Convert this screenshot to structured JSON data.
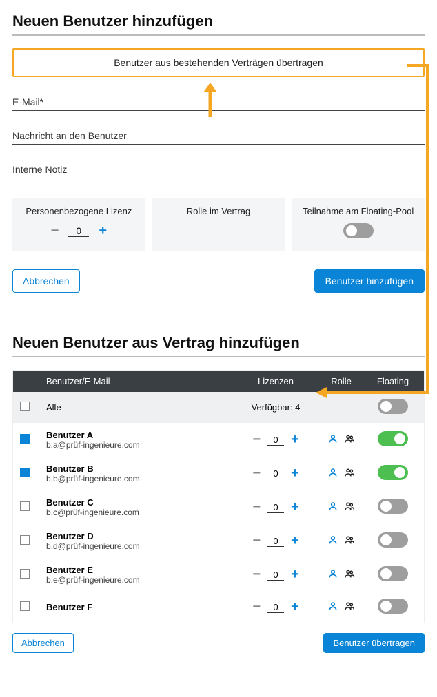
{
  "top": {
    "heading": "Neuen Benutzer hinzufügen",
    "transfer_button": "Benutzer aus bestehenden Verträgen übertragen",
    "email_label": "E-Mail*",
    "message_label": "Nachricht an den Benutzer",
    "note_label": "Interne Notiz",
    "cards": {
      "license": {
        "title": "Personenbezogene Lizenz",
        "value": "0"
      },
      "role": {
        "title": "Rolle im Vertrag"
      },
      "floating": {
        "title": "Teilnahme am Floating-Pool",
        "on": false
      }
    },
    "cancel": "Abbrechen",
    "submit": "Benutzer hinzufügen"
  },
  "bottom": {
    "heading": "Neuen Benutzer aus Vertrag hinzufügen",
    "columns": {
      "user": "Benutzer/E-Mail",
      "lic": "Lizenzen",
      "role": "Rolle",
      "float": "Floating"
    },
    "all_label": "Alle",
    "available": "Verfügbar: 4",
    "rows": [
      {
        "checked": true,
        "name": "Benutzer A",
        "mail": "b.a@prüf-ingenieure.com",
        "lic": "0",
        "float_on": true
      },
      {
        "checked": true,
        "name": "Benutzer B",
        "mail": "b.b@prüf-ingenieure.com",
        "lic": "0",
        "float_on": true
      },
      {
        "checked": false,
        "name": "Benutzer C",
        "mail": "b.c@prüf-ingenieure.com",
        "lic": "0",
        "float_on": false
      },
      {
        "checked": false,
        "name": "Benutzer D",
        "mail": "b.d@prüf-ingenieure.com",
        "lic": "0",
        "float_on": false
      },
      {
        "checked": false,
        "name": "Benutzer E",
        "mail": "b.e@prüf-ingenieure.com",
        "lic": "0",
        "float_on": false
      },
      {
        "checked": false,
        "name": "Benutzer F",
        "mail": "",
        "lic": "0",
        "float_on": false
      }
    ],
    "cancel": "Abbrechen",
    "submit": "Benutzer übertragen"
  },
  "colors": {
    "accent": "#f5a623",
    "primary": "#0a84d6"
  }
}
